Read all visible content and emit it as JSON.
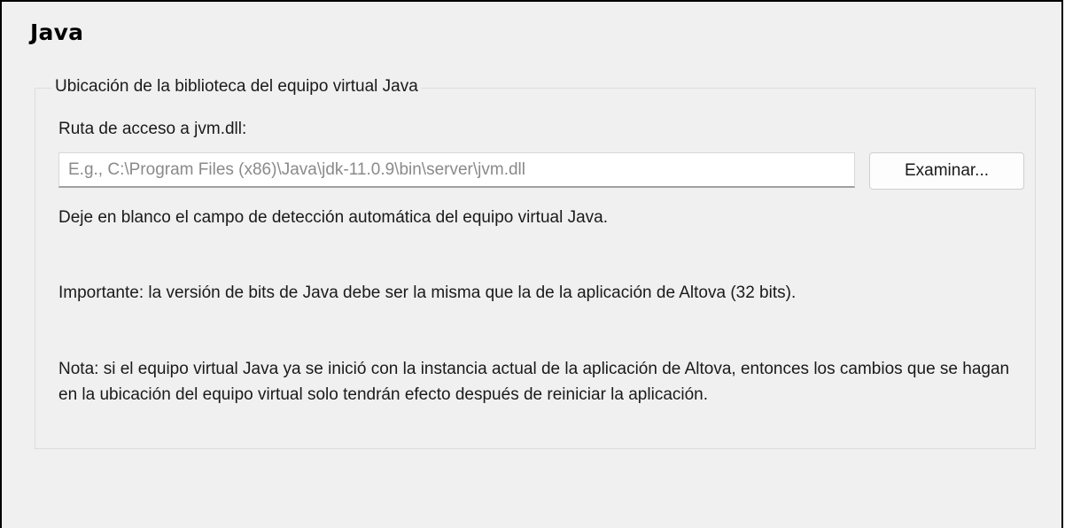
{
  "page": {
    "title": "Java"
  },
  "group": {
    "legend": "Ubicación de la biblioteca del equipo virtual Java",
    "path_label": "Ruta de acceso a jvm.dll:",
    "path_input": {
      "value": "",
      "placeholder": "E.g., C:\\Program Files (x86)\\Java\\jdk-11.0.9\\bin\\server\\jvm.dll"
    },
    "browse_button_label": "Examinar...",
    "hint_text": "Deje en blanco el campo de detección automática del equipo virtual Java.",
    "important_text": "Importante: la versión de bits de Java debe ser la misma que la de la aplicación de Altova (32 bits).",
    "note_text": "Nota: si el equipo virtual Java ya se inició con la instancia actual de la aplicación de Altova, entonces los cambios que se hagan en la ubicación del equipo virtual solo tendrán efecto después de reiniciar la aplicación."
  },
  "colors": {
    "background": "#f0f0f0",
    "border": "#000000",
    "group_border": "#dcdcdc",
    "placeholder_text": "#8a8a8a"
  }
}
